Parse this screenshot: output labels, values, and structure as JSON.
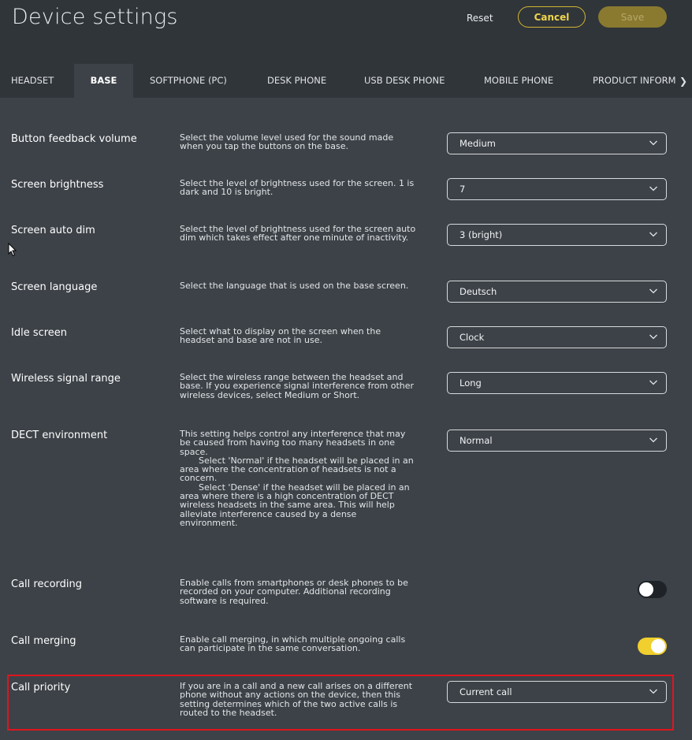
{
  "header": {
    "title": "Device settings",
    "reset_label": "Reset",
    "cancel_label": "Cancel",
    "save_label": "Save"
  },
  "tabs": [
    {
      "label": "HEADSET",
      "active": false
    },
    {
      "label": "BASE",
      "active": true
    },
    {
      "label": "SOFTPHONE (PC)",
      "active": false
    },
    {
      "label": "DESK PHONE",
      "active": false
    },
    {
      "label": "USB DESK PHONE",
      "active": false
    },
    {
      "label": "MOBILE PHONE",
      "active": false
    },
    {
      "label": "PRODUCT INFORM",
      "active": false
    }
  ],
  "settings": {
    "button_feedback_volume": {
      "label": "Button feedback volume",
      "description": "Select the volume level used for the sound made when you tap the buttons on the base.",
      "value": "Medium"
    },
    "screen_brightness": {
      "label": "Screen brightness",
      "description": "Select the level of brightness used for the screen. 1 is dark and 10 is bright.",
      "value": "7"
    },
    "screen_auto_dim": {
      "label": "Screen auto dim",
      "description": "Select the level of brightness used for the screen auto dim which takes effect after one minute of inactivity.",
      "value": "3 (bright)"
    },
    "screen_language": {
      "label": "Screen language",
      "description": "Select the language that is used on the base screen.",
      "value": "Deutsch"
    },
    "idle_screen": {
      "label": "Idle screen",
      "description": "Select what to display on the screen when the headset and base are not in use.",
      "value": "Clock"
    },
    "wireless_signal_range": {
      "label": "Wireless signal range",
      "description": "Select the wireless range between the headset and base. If you experience signal interference from other wireless devices, select Medium or Short.",
      "value": "Long"
    },
    "dect_environment": {
      "label": "DECT environment",
      "description_intro": "This setting helps control any interference that may be caused from having too many headsets in one space.",
      "description_normal": "Select 'Normal' if the headset will be placed in an area where the concentration of headsets is not a concern.",
      "description_dense": "Select 'Dense' if the headset will be placed in an area where there is a high concentration of DECT wireless headsets in the same area. This will help alleviate interference caused by a dense environment.",
      "value": "Normal"
    },
    "call_recording": {
      "label": "Call recording",
      "description": "Enable calls from smartphones or desk phones to be recorded on your computer. Additional recording software is required.",
      "enabled": false
    },
    "call_merging": {
      "label": "Call merging",
      "description": "Enable call merging, in which multiple ongoing calls can participate in the same conversation.",
      "enabled": true
    },
    "call_priority": {
      "label": "Call priority",
      "description": "If you are in a call and a new call arises on a different phone without any actions on the device, then this setting determines which of the two active calls is routed to the headset.",
      "value": "Current call"
    }
  },
  "colors": {
    "accent": "#f0cf2e",
    "background": "#3d4248",
    "header_background": "#30353a",
    "highlight": "#e0141e"
  }
}
